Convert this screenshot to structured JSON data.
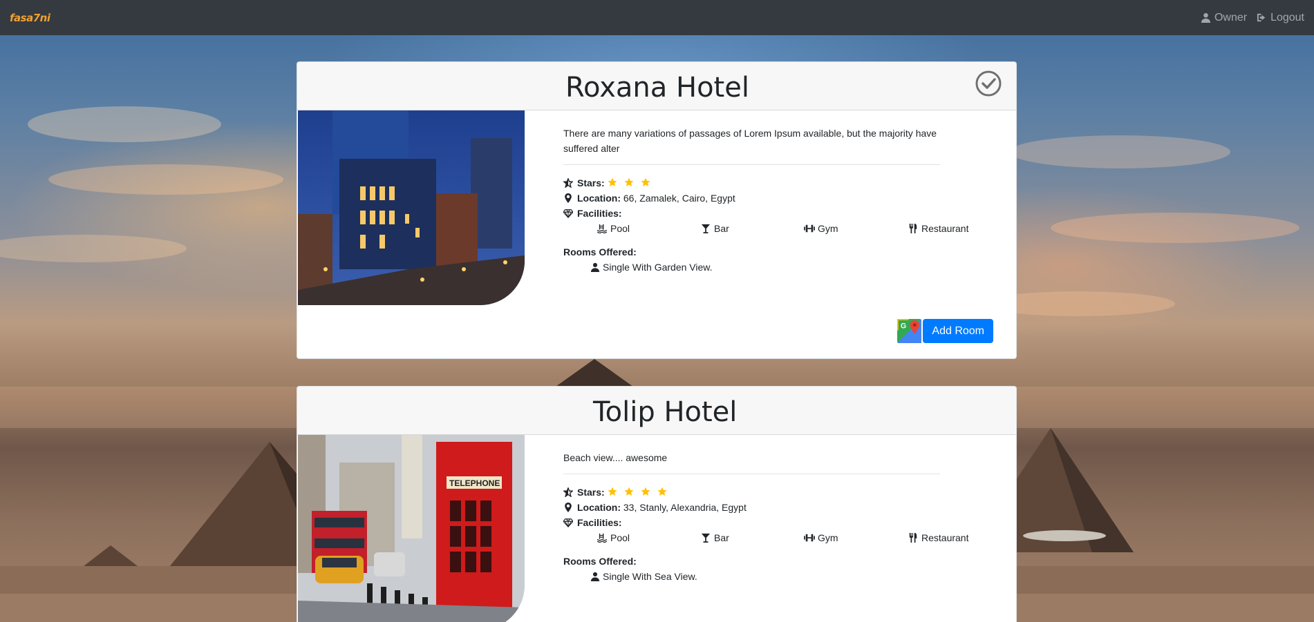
{
  "navbar": {
    "brand": "fasa7ni",
    "owner_label": "Owner",
    "logout_label": "Logout"
  },
  "colors": {
    "navbar_bg": "#343a40",
    "primary": "#007bff",
    "star": "#ffc107"
  },
  "hotels": [
    {
      "name": "Roxana Hotel",
      "verified": true,
      "description": "There are many variations of passages of Lorem Ipsum available, but the majority have suffered alter",
      "stars_label": "Stars:",
      "stars": 3,
      "location_label": "Location:",
      "location": "66, Zamalek, Cairo, Egypt",
      "facilities_label": "Facilities:",
      "facilities": [
        "Pool",
        "Bar",
        "Gym",
        "Restaurant"
      ],
      "rooms_label": "Rooms Offered:",
      "rooms": [
        "Single With Garden View."
      ],
      "add_room_label": "Add Room"
    },
    {
      "name": "Tolip Hotel",
      "verified": false,
      "description": "Beach view.... awesome",
      "stars_label": "Stars:",
      "stars": 4,
      "location_label": "Location:",
      "location": "33, Stanly, Alexandria, Egypt",
      "facilities_label": "Facilities:",
      "facilities": [
        "Pool",
        "Bar",
        "Gym",
        "Restaurant"
      ],
      "rooms_label": "Rooms Offered:",
      "rooms": [
        "Single With Sea View."
      ]
    }
  ]
}
